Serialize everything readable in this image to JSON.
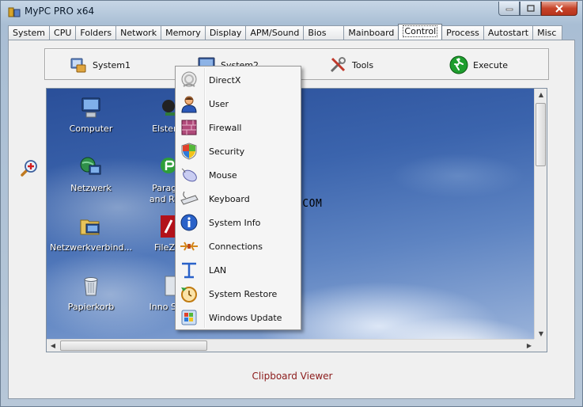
{
  "window": {
    "title": "MyPC PRO x64"
  },
  "tabs": [
    {
      "label": "System"
    },
    {
      "label": "CPU"
    },
    {
      "label": "Folders"
    },
    {
      "label": "Network"
    },
    {
      "label": "Memory"
    },
    {
      "label": "Display"
    },
    {
      "label": "APM/Sound"
    },
    {
      "label": "Bios"
    },
    {
      "label": "Mainboard"
    },
    {
      "label": "Control"
    },
    {
      "label": "Process"
    },
    {
      "label": "Autostart"
    },
    {
      "label": "Misc"
    }
  ],
  "active_tab": "Control",
  "toolbar": {
    "system1": "System1",
    "system2": "System2",
    "tools": "Tools",
    "execute": "Execute"
  },
  "desktop_icons": {
    "computer": "Computer",
    "elster": "ElsterF",
    "netzwerk": "Netzwerk",
    "paragon_1": "Parago",
    "paragon_2": "and Rec",
    "netzwerkverbind": "Netzwerkverbind...",
    "filezilla": "FileZil",
    "papierkorb": "Papierkorb",
    "inno": "Inno Scr"
  },
  "context_menu": [
    {
      "label": "DirectX",
      "icon": "directx-icon"
    },
    {
      "label": "User",
      "icon": "user-icon"
    },
    {
      "label": "Firewall",
      "icon": "firewall-icon"
    },
    {
      "label": "Security",
      "icon": "security-shield-icon"
    },
    {
      "label": "Mouse",
      "icon": "mouse-icon"
    },
    {
      "label": "Keyboard",
      "icon": "keyboard-icon"
    },
    {
      "label": "System Info",
      "icon": "info-icon"
    },
    {
      "label": "Connections",
      "icon": "connections-icon"
    },
    {
      "label": "LAN",
      "icon": "lan-icon"
    },
    {
      "label": "System Restore",
      "icon": "restore-icon"
    },
    {
      "label": "Windows Update",
      "icon": "windows-update-icon"
    }
  ],
  "watermark": "JSOFTJ.COM",
  "clipboard_viewer": "Clipboard Viewer",
  "colors": {
    "clipboard_text": "#8b1a1a",
    "desktop_sky": "#3b64ad",
    "execute_green": "#1e9e2e"
  }
}
